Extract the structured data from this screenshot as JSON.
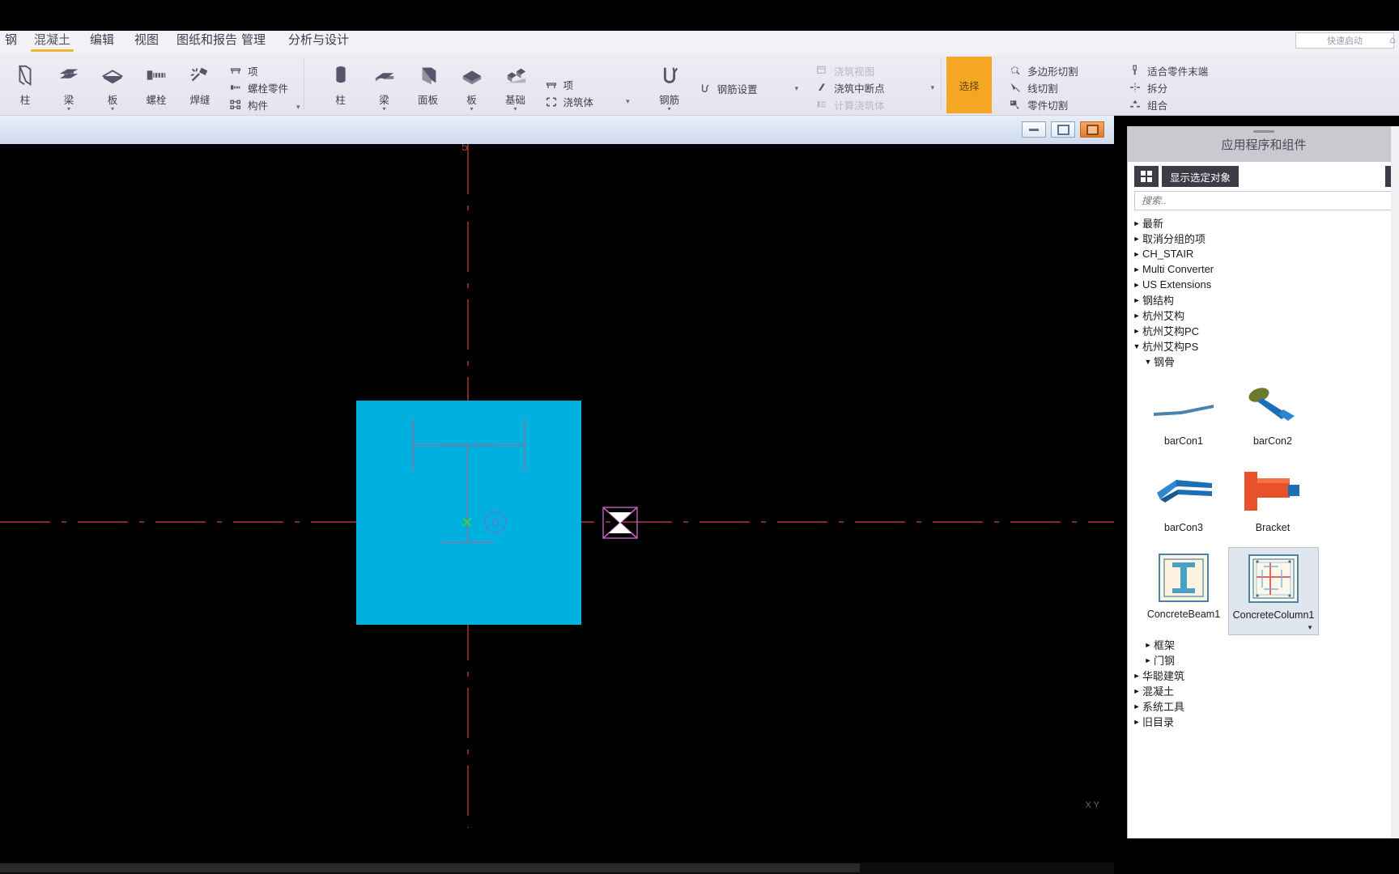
{
  "menu": {
    "items": [
      {
        "label": "钢",
        "active": false
      },
      {
        "label": "混凝土",
        "active": true
      },
      {
        "label": "编辑",
        "active": false
      },
      {
        "label": "视图",
        "active": false
      },
      {
        "label": "图纸和报告",
        "active": false
      },
      {
        "label": "管理",
        "active": false
      },
      {
        "label": "分析与设计",
        "active": false
      }
    ],
    "quick_access": "快速启动"
  },
  "ribbon": {
    "group_steel": {
      "big": [
        {
          "label": "柱",
          "icon": "column-icon",
          "dropdown": false
        },
        {
          "label": "梁",
          "icon": "beam-icon",
          "dropdown": true
        },
        {
          "label": "板",
          "icon": "plate-icon",
          "dropdown": true
        },
        {
          "label": "螺栓",
          "icon": "bolt-icon",
          "dropdown": false
        },
        {
          "label": "焊缝",
          "icon": "weld-icon",
          "dropdown": false
        }
      ],
      "small": [
        {
          "label": "项",
          "icon": "item-icon",
          "disabled": false
        },
        {
          "label": "螺栓零件",
          "icon": "bolt-part-icon",
          "disabled": false
        },
        {
          "label": "构件",
          "icon": "assembly-icon",
          "disabled": false
        }
      ],
      "more_caret": "▼"
    },
    "group_concrete": {
      "big": [
        {
          "label": "柱",
          "icon": "concrete-column-icon",
          "dropdown": false
        },
        {
          "label": "梁",
          "icon": "concrete-beam-icon",
          "dropdown": true
        },
        {
          "label": "面板",
          "icon": "panel-icon",
          "dropdown": false
        },
        {
          "label": "板",
          "icon": "slab-icon",
          "dropdown": true
        },
        {
          "label": "基础",
          "icon": "footing-icon",
          "dropdown": true
        }
      ],
      "small": [
        {
          "label": "项",
          "icon": "item-icon",
          "disabled": false
        },
        {
          "label": "浇筑体",
          "icon": "cast-unit-icon",
          "disabled": false,
          "caret": "▼"
        }
      ]
    },
    "group_rebar": {
      "big": [
        {
          "label": "钢筋",
          "icon": "rebar-icon",
          "dropdown": true
        }
      ],
      "small": [
        {
          "label": "钢筋设置",
          "icon": "rebar-settings-icon",
          "disabled": false,
          "caret": "▼"
        }
      ]
    },
    "group_pour": {
      "small": [
        {
          "label": "浇筑视图",
          "icon": "pour-view-icon",
          "disabled": true
        },
        {
          "label": "浇筑中断点",
          "icon": "pour-break-icon",
          "disabled": false,
          "caret": "▼"
        },
        {
          "label": "计算浇筑体",
          "icon": "calc-pour-icon",
          "disabled": true
        }
      ]
    },
    "select_button": {
      "label": "选择"
    },
    "group_cut": {
      "small": [
        {
          "label": "多边形切割",
          "icon": "polygon-cut-icon"
        },
        {
          "label": "线切割",
          "icon": "line-cut-icon"
        },
        {
          "label": "零件切割",
          "icon": "part-cut-icon"
        }
      ]
    },
    "group_fit": {
      "small": [
        {
          "label": "适合零件末端",
          "icon": "fit-part-end-icon"
        },
        {
          "label": "拆分",
          "icon": "split-icon"
        },
        {
          "label": "组合",
          "icon": "combine-icon"
        }
      ]
    }
  },
  "view_window": {
    "buttons": [
      {
        "name": "minimize",
        "glyph": "—"
      },
      {
        "name": "restore",
        "glyph": "❐"
      },
      {
        "name": "close",
        "glyph": "✕"
      }
    ]
  },
  "canvas": {
    "grid_label_top": "5",
    "column_fill_color": "#00b0de",
    "grid_line_color": "#b03b3b",
    "section_color": "#5a7fa8",
    "cursor_color": "#c060c0"
  },
  "right_panel": {
    "title": "应用程序和组件",
    "toolbar": {
      "grid_icon": "grid-view-icon",
      "show_selected_label": "显示选定对象"
    },
    "search": {
      "placeholder": "搜索..",
      "value": ""
    },
    "tree": [
      {
        "label": "最新",
        "indent": 0,
        "expanded": false
      },
      {
        "label": "取消分组的项",
        "indent": 0,
        "expanded": false
      },
      {
        "label": "CH_STAIR",
        "indent": 0,
        "expanded": false
      },
      {
        "label": "Multi Converter",
        "indent": 0,
        "expanded": false
      },
      {
        "label": "US Extensions",
        "indent": 0,
        "expanded": false
      },
      {
        "label": "钢结构",
        "indent": 0,
        "expanded": false
      },
      {
        "label": "杭州艾构",
        "indent": 0,
        "expanded": false
      },
      {
        "label": "杭州艾构PC",
        "indent": 0,
        "expanded": false
      },
      {
        "label": "杭州艾构PS",
        "indent": 0,
        "expanded": true
      },
      {
        "label": "钢骨",
        "indent": 1,
        "expanded": true
      }
    ],
    "components": [
      {
        "label": "barCon1",
        "icon": "bar-connection-1",
        "selected": false
      },
      {
        "label": "barCon2",
        "icon": "bar-connection-2",
        "selected": false
      },
      {
        "label": "barCon3",
        "icon": "bar-connection-3",
        "selected": false
      },
      {
        "label": "Bracket",
        "icon": "bracket-component",
        "selected": false
      },
      {
        "label": "ConcreteBeam1",
        "icon": "concrete-beam-section",
        "selected": false
      },
      {
        "label": "ConcreteColumn1",
        "icon": "concrete-column-section",
        "selected": true,
        "caret": "▼"
      }
    ],
    "tree_after": [
      {
        "label": "框架",
        "indent": 1,
        "expanded": false
      },
      {
        "label": "门钢",
        "indent": 1,
        "expanded": false
      },
      {
        "label": "华聪建筑",
        "indent": 0,
        "expanded": false
      },
      {
        "label": "混凝土",
        "indent": 0,
        "expanded": false
      },
      {
        "label": "系统工具",
        "indent": 0,
        "expanded": false
      },
      {
        "label": "旧目录",
        "indent": 0,
        "expanded": false
      }
    ]
  }
}
